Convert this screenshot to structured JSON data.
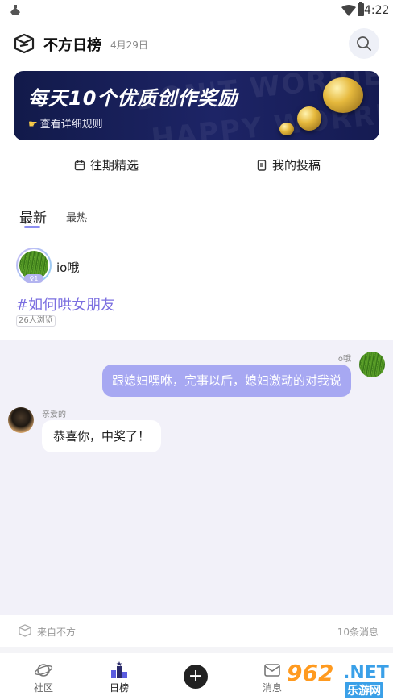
{
  "status_bar": {
    "time": "4:22"
  },
  "header": {
    "title": "不方日榜",
    "date": "4月29日"
  },
  "banner": {
    "headline": "每天10个优质创作奖励",
    "rule_link": "查看详细规则",
    "bg_text_1": "DON'T WORRIED BE",
    "bg_text_2": "HAPPY WORRIED D"
  },
  "subtabs": {
    "past": "往期精选",
    "mine": "我的投稿"
  },
  "feed_tabs": {
    "latest": "最新",
    "hot": "最热"
  },
  "post": {
    "username": "io哦",
    "level": "1",
    "topic": "#如何哄女朋友",
    "views": "26人浏览"
  },
  "chat": {
    "me_name": "io哦",
    "me_message": "跟媳妇嘿咻，完事以后，媳妇激动的对我说",
    "other_name": "亲爱的",
    "other_message": "恭喜你，中奖了！"
  },
  "source": {
    "label": "来自不方",
    "count": "10条消息"
  },
  "tabbar": {
    "community": "社区",
    "daily": "日榜",
    "messages": "消息"
  },
  "watermark": {
    "num": "962",
    "net": ".NET",
    "cn": "乐游网"
  },
  "colors": {
    "accent": "#8b8ef0",
    "bubble_me": "#a7a8f2",
    "topic": "#7b6fe0",
    "chat_bg": "#f2f1f9",
    "banner": "#1d2466"
  }
}
